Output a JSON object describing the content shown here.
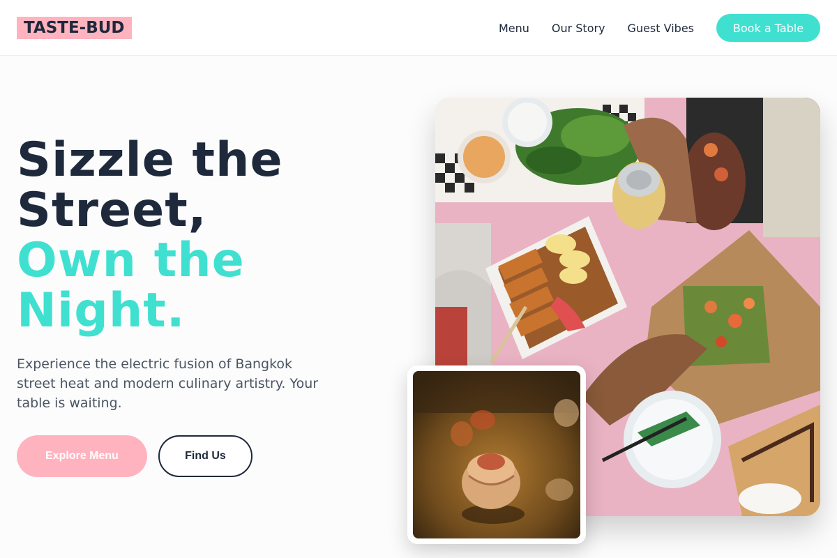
{
  "brand": {
    "logo": "TASTE-BUD"
  },
  "nav": {
    "items": [
      "Menu",
      "Our Story",
      "Guest Vibes"
    ],
    "cta": "Book a Table"
  },
  "hero": {
    "title_line1": "Sizzle the",
    "title_line2": "Street,",
    "title_line3": "Own the",
    "title_line4": "Night.",
    "subtitle": "Experience the electric fusion of Bangkok street heat and modern culinary artistry. Your table is waiting.",
    "primary_button": "Explore Menu",
    "secondary_button": "Find Us"
  },
  "images": {
    "main": "street-food-spread-photo",
    "thumb": "night-dumpling-photo"
  },
  "colors": {
    "accent_teal": "#40e0d0",
    "accent_pink": "#ffb3bf",
    "text_dark": "#1e293b"
  }
}
